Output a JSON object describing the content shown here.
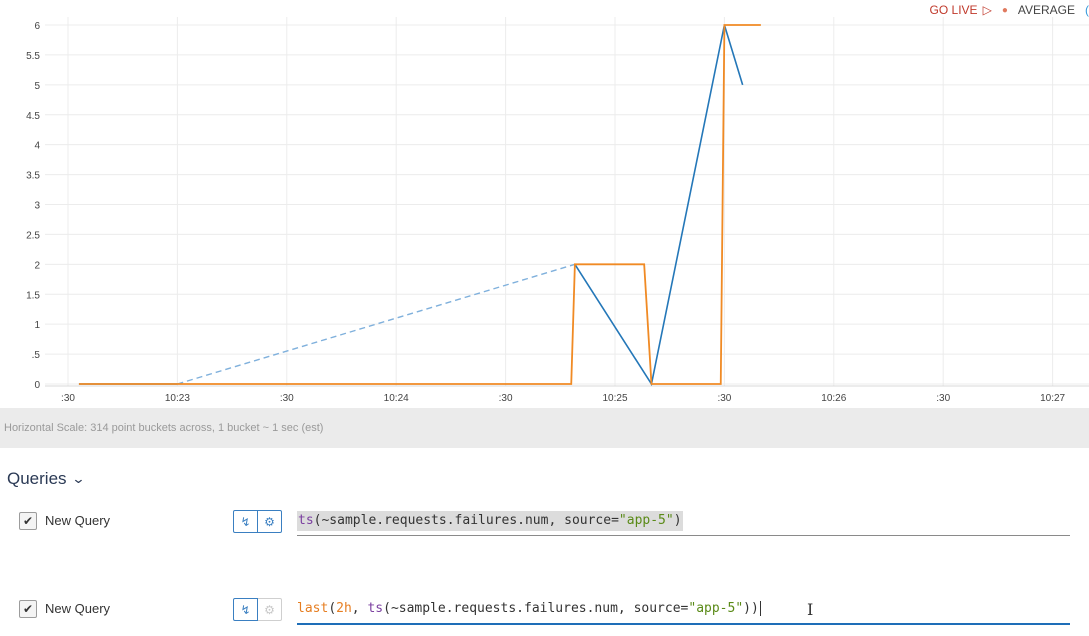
{
  "controls": {
    "go_live": "GO LIVE",
    "go_live_icon": "play-outline-icon",
    "aggregation": "AVERAGE",
    "overflow_glyph": "("
  },
  "chart_data": {
    "type": "line",
    "ylim": [
      0,
      6
    ],
    "y_ticks": [
      "0",
      ".5",
      "1",
      "1.5",
      "2",
      "2.5",
      "3",
      "3.5",
      "4",
      "4.5",
      "5",
      "5.5",
      "6"
    ],
    "x_tick_labels": [
      ":30",
      "10:23",
      ":30",
      "10:24",
      ":30",
      "10:25",
      ":30",
      "10:26",
      ":30",
      "10:27"
    ],
    "xlim_seconds": [
      -27,
      135
    ],
    "grid": true,
    "series": [
      {
        "color": "#2477b8",
        "points": [
          [
            -27,
            0
          ],
          [
            0,
            0
          ],
          [
            109,
            2
          ],
          [
            130,
            0
          ],
          [
            150,
            6
          ],
          [
            155,
            5
          ]
        ],
        "dashed_segment": [
          [
            0,
            0
          ],
          [
            109,
            2
          ]
        ]
      },
      {
        "color": "#f08a24",
        "points": [
          [
            -27,
            0
          ],
          [
            108,
            0
          ],
          [
            109,
            2
          ],
          [
            128,
            2
          ],
          [
            130,
            0
          ],
          [
            149,
            0
          ],
          [
            150,
            6
          ],
          [
            160,
            6
          ]
        ]
      }
    ]
  },
  "scale_text": "Horizontal Scale: 314 point buckets across, 1 bucket ~ 1 sec (est)",
  "queries": {
    "title": "Queries",
    "items": [
      {
        "name": "New Query",
        "checked": true,
        "fn": "ts",
        "metric": "~sample.requests.failures.num",
        "tag_key": "source",
        "tag_val": "\"app-5\""
      },
      {
        "name": "New Query",
        "checked": true,
        "outer_fn": "last",
        "window": "2h",
        "fn": "ts",
        "metric": "~sample.requests.failures.num",
        "tag_key": "source",
        "tag_val": "\"app-5\""
      }
    ]
  }
}
